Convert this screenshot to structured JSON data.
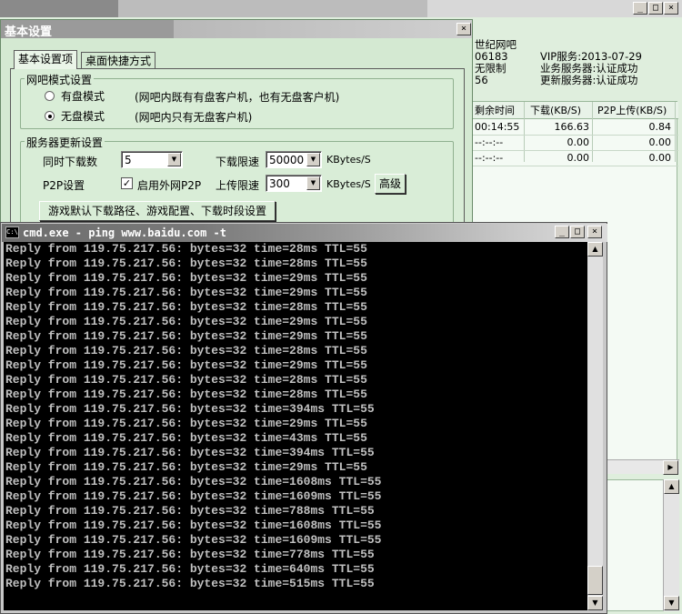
{
  "main_window": {
    "controls": {
      "minimize": "_",
      "maximize": "□",
      "close": "×"
    },
    "info": {
      "name": "世纪网吧",
      "id": "06183",
      "limit": "无限制",
      "extra": "56",
      "vip": "VIP服务:2013-07-29",
      "biz_server": "业务服务器:认证成功",
      "update_server": "更新服务器:认证成功"
    },
    "table": {
      "headers": [
        "剩余时间",
        "下载(KB/S)",
        "P2P上传(KB/S)"
      ],
      "rows": [
        [
          "00:14:55",
          "166.63",
          "0.84"
        ],
        [
          "--:--:--",
          "0.00",
          "0.00"
        ],
        [
          "--:--:--",
          "0.00",
          "0.00"
        ]
      ]
    }
  },
  "dialog": {
    "title": "基本设置",
    "tabs": [
      "基本设置项",
      "桌面快捷方式"
    ],
    "mode_group": {
      "legend": "网吧模式设置",
      "options": [
        {
          "label": "有盘模式",
          "desc": "(网吧内既有有盘客户机，也有无盘客户机)",
          "selected": false
        },
        {
          "label": "无盘模式",
          "desc": "(网吧内只有无盘客户机)",
          "selected": true
        }
      ]
    },
    "server_group": {
      "legend": "服务器更新设置",
      "concurrent_label": "同时下载数",
      "concurrent_value": "5",
      "download_limit_label": "下载限速",
      "download_limit_value": "50000",
      "upload_limit_label": "上传限速",
      "upload_limit_value": "300",
      "unit": "KBytes/S",
      "p2p_label": "P2P设置",
      "p2p_checkbox_label": "启用外网P2P",
      "p2p_checked": true,
      "advanced_button": "高级",
      "game_button": "游戏默认下载路径、游戏配置、下载时段设置"
    }
  },
  "cmd": {
    "icon_text": "C:\\",
    "title": "cmd.exe - ping www.baidu.com -t",
    "lines": [
      "Reply from 119.75.217.56: bytes=32 time=28ms TTL=55",
      "Reply from 119.75.217.56: bytes=32 time=28ms TTL=55",
      "Reply from 119.75.217.56: bytes=32 time=29ms TTL=55",
      "Reply from 119.75.217.56: bytes=32 time=29ms TTL=55",
      "Reply from 119.75.217.56: bytes=32 time=28ms TTL=55",
      "Reply from 119.75.217.56: bytes=32 time=29ms TTL=55",
      "Reply from 119.75.217.56: bytes=32 time=29ms TTL=55",
      "Reply from 119.75.217.56: bytes=32 time=28ms TTL=55",
      "Reply from 119.75.217.56: bytes=32 time=29ms TTL=55",
      "Reply from 119.75.217.56: bytes=32 time=28ms TTL=55",
      "Reply from 119.75.217.56: bytes=32 time=28ms TTL=55",
      "Reply from 119.75.217.56: bytes=32 time=394ms TTL=55",
      "Reply from 119.75.217.56: bytes=32 time=29ms TTL=55",
      "Reply from 119.75.217.56: bytes=32 time=43ms TTL=55",
      "Reply from 119.75.217.56: bytes=32 time=394ms TTL=55",
      "Reply from 119.75.217.56: bytes=32 time=29ms TTL=55",
      "Reply from 119.75.217.56: bytes=32 time=1608ms TTL=55",
      "Reply from 119.75.217.56: bytes=32 time=1609ms TTL=55",
      "Reply from 119.75.217.56: bytes=32 time=788ms TTL=55",
      "Reply from 119.75.217.56: bytes=32 time=1608ms TTL=55",
      "Reply from 119.75.217.56: bytes=32 time=1609ms TTL=55",
      "Reply from 119.75.217.56: bytes=32 time=778ms TTL=55",
      "Reply from 119.75.217.56: bytes=32 time=640ms TTL=55",
      "Reply from 119.75.217.56: bytes=32 time=515ms TTL=55"
    ]
  }
}
